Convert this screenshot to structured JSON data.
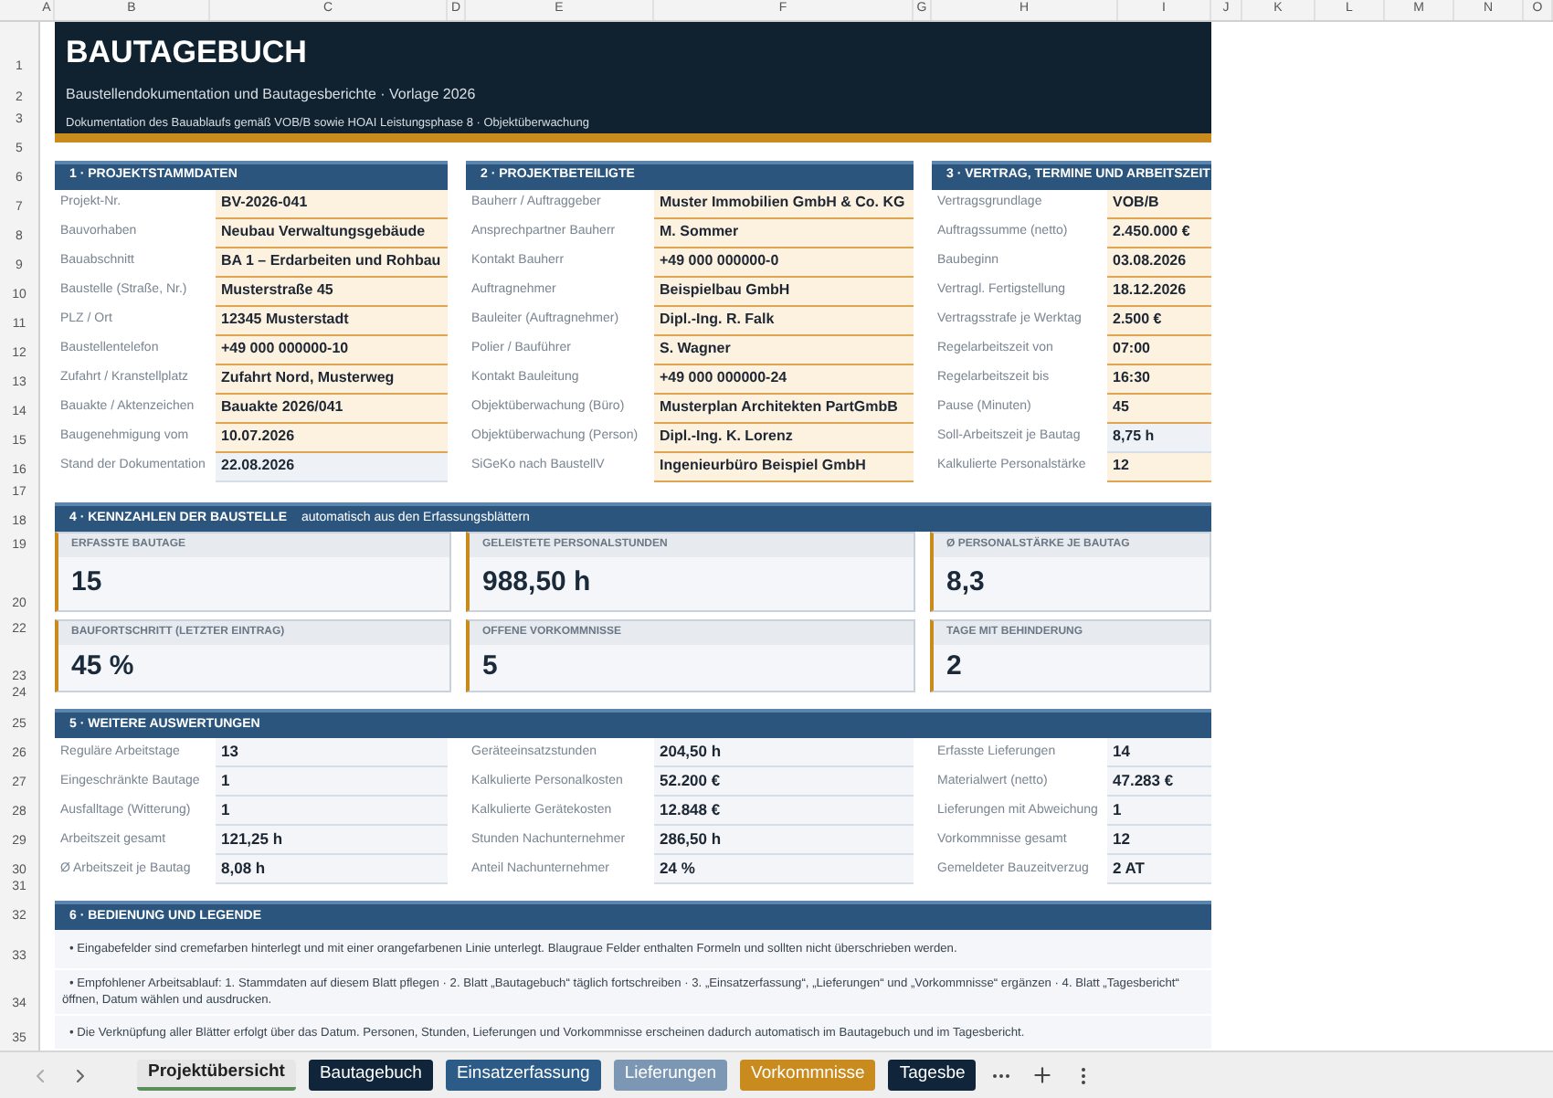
{
  "column_headers": [
    "A",
    "B",
    "C",
    "D",
    "E",
    "F",
    "G",
    "H",
    "I",
    "J",
    "K",
    "L",
    "M",
    "N",
    "O"
  ],
  "row_headers": [
    "1",
    "2",
    "3",
    "5",
    "6",
    "7",
    "8",
    "9",
    "10",
    "11",
    "12",
    "13",
    "14",
    "15",
    "16",
    "17",
    "18",
    "19",
    "20",
    "22",
    "23",
    "24",
    "25",
    "26",
    "27",
    "28",
    "29",
    "30",
    "31",
    "32",
    "33",
    "34",
    "35"
  ],
  "header": {
    "title": "BAUTAGEBUCH",
    "subtitle": "Baustellendokumentation und Bautagesberichte · Vorlage 2026",
    "description": "Dokumentation des Bauablaufs gemäß VOB/B sowie HOAI Leistungsphase 8 · Objektüberwachung"
  },
  "top_sections": [
    {
      "title": "1 · PROJEKTSTAMMDATEN",
      "rows": [
        {
          "label": "Projekt-Nr.",
          "value": "BV-2026-041",
          "kind": "input"
        },
        {
          "label": "Bauvorhaben",
          "value": "Neubau Verwaltungsgebäude",
          "kind": "input"
        },
        {
          "label": "Bauabschnitt",
          "value": "BA 1 – Erdarbeiten und Rohbau",
          "kind": "input"
        },
        {
          "label": "Baustelle (Straße, Nr.)",
          "value": "Musterstraße 45",
          "kind": "input"
        },
        {
          "label": "PLZ / Ort",
          "value": "12345 Musterstadt",
          "kind": "input"
        },
        {
          "label": "Baustellentelefon",
          "value": "+49 000 000000-10",
          "kind": "input"
        },
        {
          "label": "Zufahrt / Kranstellplatz",
          "value": "Zufahrt Nord, Musterweg",
          "kind": "input"
        },
        {
          "label": "Bauakte / Aktenzeichen",
          "value": "Bauakte 2026/041",
          "kind": "input"
        },
        {
          "label": "Baugenehmigung vom",
          "value": "10.07.2026",
          "kind": "input"
        },
        {
          "label": "Stand der Dokumentation",
          "value": "22.08.2026",
          "kind": "formula"
        }
      ]
    },
    {
      "title": "2 · PROJEKTBETEILIGTE",
      "rows": [
        {
          "label": "Bauherr / Auftraggeber",
          "value": "Muster Immobilien GmbH & Co. KG",
          "kind": "input"
        },
        {
          "label": "Ansprechpartner Bauherr",
          "value": "M. Sommer",
          "kind": "input"
        },
        {
          "label": "Kontakt Bauherr",
          "value": "+49 000 000000-0",
          "kind": "input"
        },
        {
          "label": "Auftragnehmer",
          "value": "Beispielbau GmbH",
          "kind": "input"
        },
        {
          "label": "Bauleiter (Auftragnehmer)",
          "value": "Dipl.-Ing. R. Falk",
          "kind": "input"
        },
        {
          "label": "Polier / Bauführer",
          "value": "S. Wagner",
          "kind": "input"
        },
        {
          "label": "Kontakt Bauleitung",
          "value": "+49 000 000000-24",
          "kind": "input"
        },
        {
          "label": "Objektüberwachung (Büro)",
          "value": "Musterplan Architekten PartGmbB",
          "kind": "input"
        },
        {
          "label": "Objektüberwachung (Person)",
          "value": "Dipl.-Ing. K. Lorenz",
          "kind": "input"
        },
        {
          "label": "SiGeKo nach BaustellV",
          "value": "Ingenieurbüro Beispiel GmbH",
          "kind": "input"
        }
      ]
    },
    {
      "title": "3 · VERTRAG, TERMINE UND ARBEITSZEIT",
      "rows": [
        {
          "label": "Vertragsgrundlage",
          "value": "VOB/B",
          "kind": "input"
        },
        {
          "label": "Auftragssumme (netto)",
          "value": "2.450.000 €",
          "kind": "input"
        },
        {
          "label": "Baubeginn",
          "value": "03.08.2026",
          "kind": "input"
        },
        {
          "label": "Vertragl. Fertigstellung",
          "value": "18.12.2026",
          "kind": "input"
        },
        {
          "label": "Vertragsstrafe je Werktag",
          "value": "2.500 €",
          "kind": "input"
        },
        {
          "label": "Regelarbeitszeit von",
          "value": "07:00",
          "kind": "input"
        },
        {
          "label": "Regelarbeitszeit bis",
          "value": "16:30",
          "kind": "input"
        },
        {
          "label": "Pause (Minuten)",
          "value": "45",
          "kind": "input"
        },
        {
          "label": "Soll-Arbeitszeit je Bautag",
          "value": "8,75 h",
          "kind": "formula"
        },
        {
          "label": "Kalkulierte Personalstärke",
          "value": "12",
          "kind": "input"
        }
      ]
    }
  ],
  "kpis": {
    "title": "4 · KENNZAHLEN DER BAUSTELLE",
    "note": "automatisch aus den Erfassungsblättern",
    "items": [
      {
        "label": "ERFASSTE BAUTAGE",
        "value": "15"
      },
      {
        "label": "GELEISTETE PERSONALSTUNDEN",
        "value": "988,50 h"
      },
      {
        "label": "Ø PERSONALSTÄRKE JE BAUTAG",
        "value": "8,3"
      },
      {
        "label": "BAUFORTSCHRITT (LETZTER EINTRAG)",
        "value": "45 %"
      },
      {
        "label": "OFFENE VORKOMMNISSE",
        "value": "5"
      },
      {
        "label": "TAGE MIT BEHINDERUNG",
        "value": "2"
      }
    ]
  },
  "evaluations": {
    "title": "5 · WEITERE AUSWERTUNGEN",
    "columns": [
      [
        {
          "label": "Reguläre Arbeitstage",
          "value": "13"
        },
        {
          "label": "Eingeschränkte Bautage",
          "value": "1"
        },
        {
          "label": "Ausfalltage (Witterung)",
          "value": "1"
        },
        {
          "label": "Arbeitszeit gesamt",
          "value": "121,25 h"
        },
        {
          "label": "Ø Arbeitszeit je Bautag",
          "value": "8,08 h"
        }
      ],
      [
        {
          "label": "Geräteeinsatzstunden",
          "value": "204,50 h"
        },
        {
          "label": "Kalkulierte Personalkosten",
          "value": "52.200 €"
        },
        {
          "label": "Kalkulierte Gerätekosten",
          "value": "12.848 €"
        },
        {
          "label": "Stunden Nachunternehmer",
          "value": "286,50 h"
        },
        {
          "label": "Anteil Nachunternehmer",
          "value": "24 %"
        }
      ],
      [
        {
          "label": "Erfasste Lieferungen",
          "value": "14"
        },
        {
          "label": "Materialwert (netto)",
          "value": "47.283 €"
        },
        {
          "label": "Lieferungen mit Abweichung",
          "value": "1"
        },
        {
          "label": "Vorkommnisse gesamt",
          "value": "12"
        },
        {
          "label": "Gemeldeter Bauzeitverzug",
          "value": "2 AT"
        }
      ]
    ]
  },
  "legend": {
    "title": "6 · BEDIENUNG UND LEGENDE",
    "notes": [
      "• Eingabefelder sind cremefarben hinterlegt und mit einer orangefarbenen Linie unterlegt. Blaugraue Felder enthalten Formeln und sollten nicht überschrieben werden.",
      "• Empfohlener Arbeitsablauf: 1. Stammdaten auf diesem Blatt pflegen · 2. Blatt „Bautagebuch“ täglich fortschreiben · 3. „Einsatzerfassung“, „Lieferungen“ und „Vorkommnisse“ ergänzen · 4. Blatt „Tagesbericht“ öffnen, Datum wählen und ausdrucken.",
      "• Die Verknüpfung aller Blätter erfolgt über das Datum. Personen, Stunden, Lieferungen und Vorkommnisse erscheinen dadurch automatisch im Bautagebuch und im Tagesbericht."
    ]
  },
  "sheet_tabs": [
    {
      "label": "Projektübersicht",
      "selected": true,
      "color": "#e6e6e6"
    },
    {
      "label": "Bautagebuch",
      "selected": false,
      "color": "#10243a"
    },
    {
      "label": "Einsatzerfassung",
      "selected": false,
      "color": "#2b5b86"
    },
    {
      "label": "Lieferungen",
      "selected": false,
      "color": "#7c97b4"
    },
    {
      "label": "Vorkommnisse",
      "selected": false,
      "color": "#c98a1e"
    },
    {
      "label": "Tagesbe",
      "selected": false,
      "color": "#10243a"
    }
  ]
}
